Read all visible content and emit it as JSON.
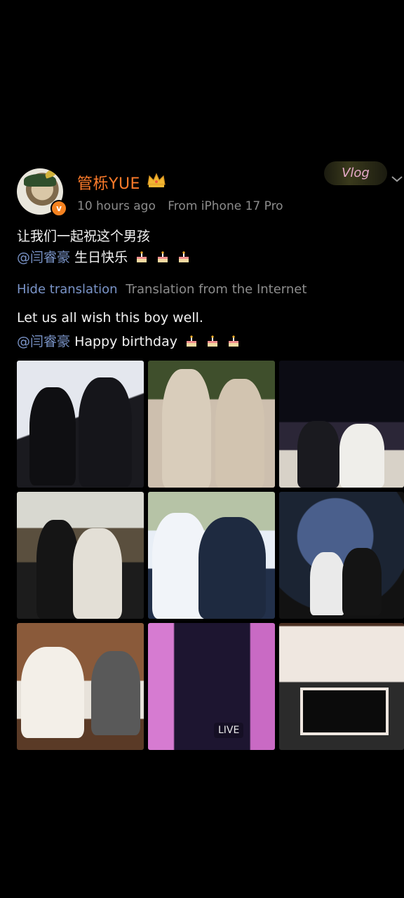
{
  "post": {
    "username": "管栎YUE",
    "verified_mark": "v",
    "time": "10 hours ago",
    "source": "From iPhone 17 Pro",
    "badge_text": "Vlog",
    "original_text_line1": "让我们一起祝这个男孩",
    "original_mention": "@闫睿豪",
    "original_text_line2": "生日快乐",
    "hide_translation": "Hide translation",
    "translation_source": "Translation from the Internet",
    "translated_line1": "Let us all wish this boy well.",
    "translated_mention": "@闫睿豪",
    "translated_line2": "Happy birthday",
    "live_label": "LIVE",
    "icons": [
      "crown-icon",
      "chevron-down-icon",
      "birthday-cake-icon"
    ],
    "colors": {
      "username": "#ff7b2a",
      "mention": "#7a94c8",
      "meta": "#8c8c8c",
      "background": "#000000"
    }
  }
}
